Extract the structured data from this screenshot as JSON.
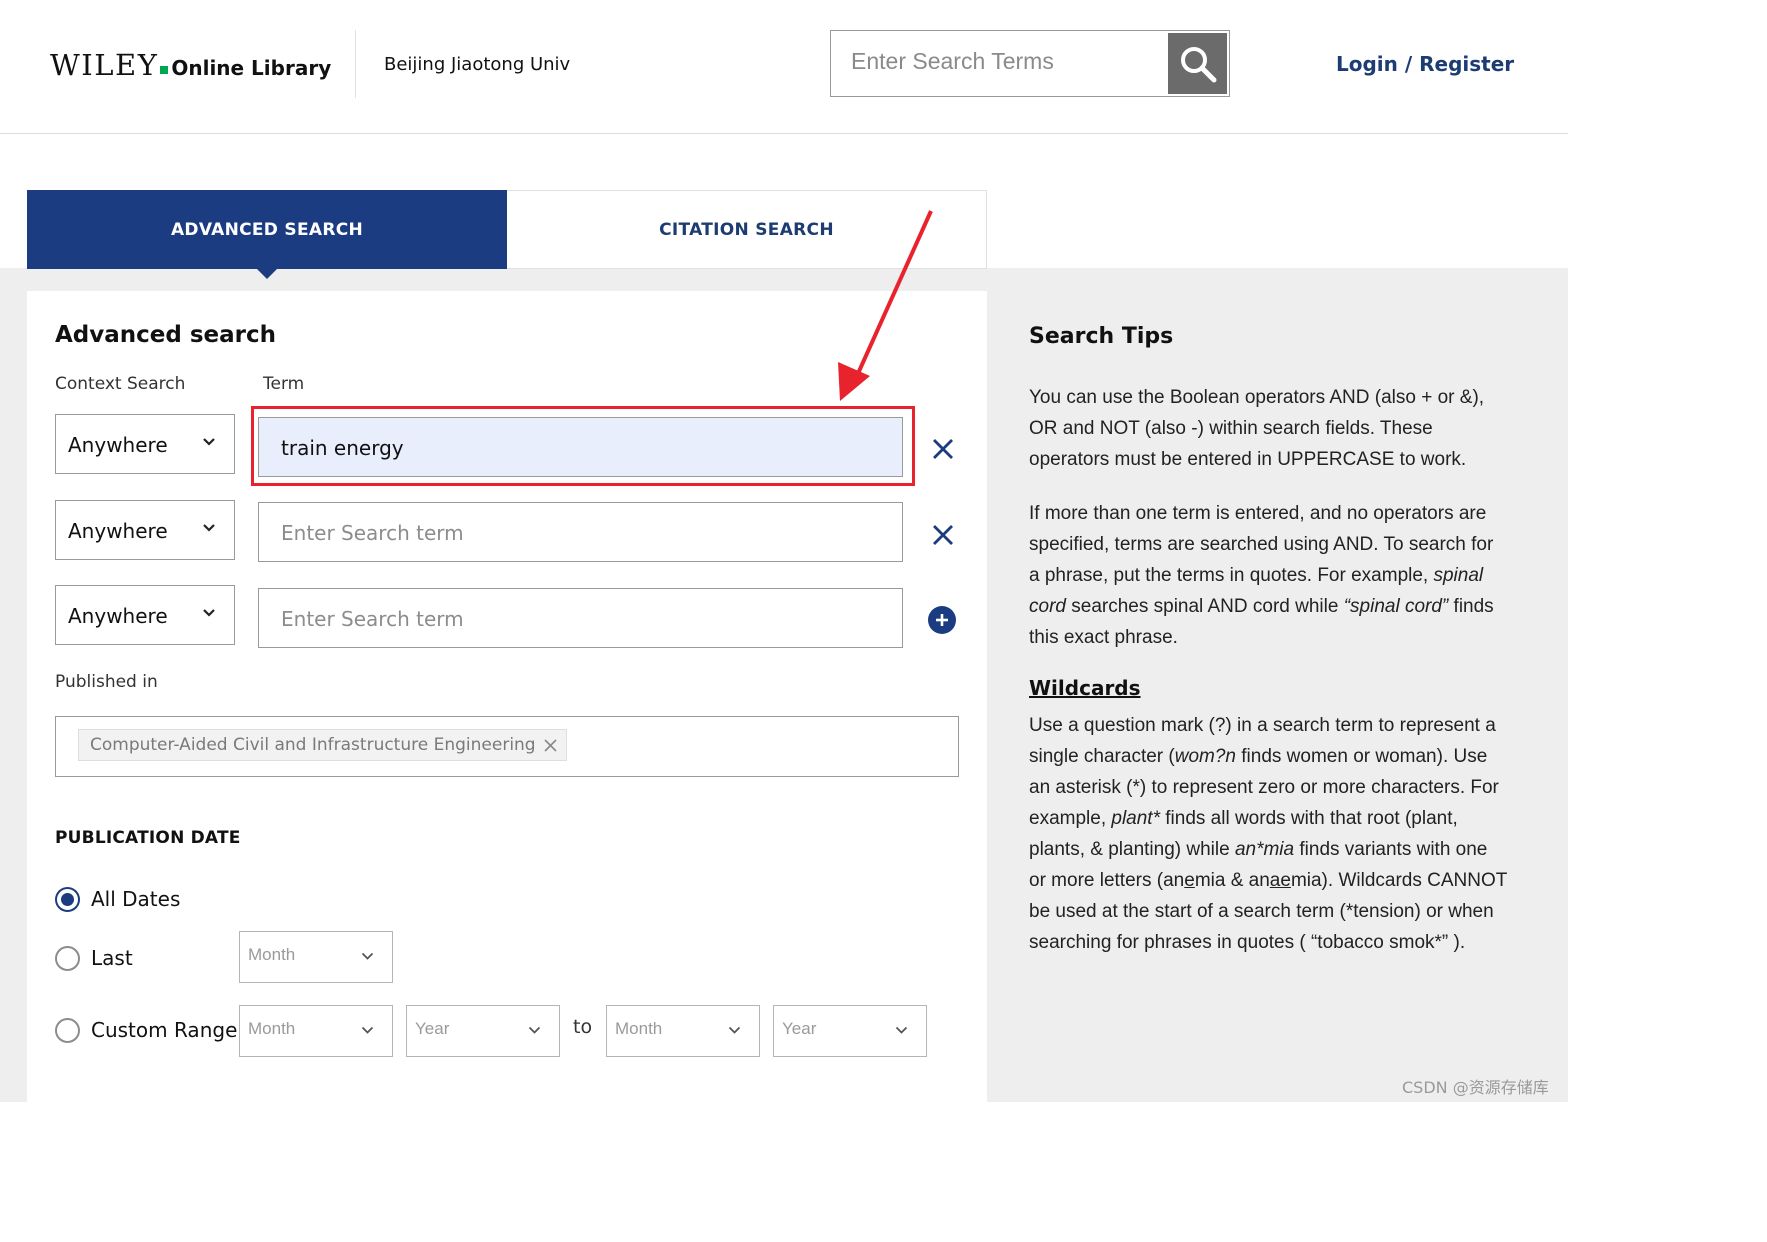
{
  "header": {
    "logo_wiley": "WILEY",
    "logo_online_library": "Online Library",
    "institution": "Beijing Jiaotong Univ",
    "search_placeholder": "Enter Search Terms",
    "login_register": "Login / Register"
  },
  "tabs": [
    {
      "label": "ADVANCED SEARCH",
      "active": true
    },
    {
      "label": "CITATION SEARCH",
      "active": false
    }
  ],
  "advanced": {
    "title": "Advanced search",
    "context_label": "Context Search",
    "term_label": "Term",
    "rows": [
      {
        "context": "Anywhere",
        "term": "train energy",
        "placeholder": "Enter Search term",
        "action": "remove"
      },
      {
        "context": "Anywhere",
        "term": "",
        "placeholder": "Enter Search term",
        "action": "remove"
      },
      {
        "context": "Anywhere",
        "term": "",
        "placeholder": "Enter Search term",
        "action": "add"
      }
    ],
    "published_in_label": "Published in",
    "published_in_chip": "Computer-Aided Civil and Infrastructure Engineering",
    "publication_date_label": "PUBLICATION DATE",
    "date_options": [
      {
        "label": "All Dates",
        "checked": true
      },
      {
        "label": "Last",
        "checked": false
      },
      {
        "label": "Custom Range",
        "checked": false
      }
    ],
    "last_month": "Month",
    "range_from_month": "Month",
    "range_from_year": "Year",
    "range_to": "to",
    "range_to_month": "Month",
    "range_to_year": "Year"
  },
  "tips": {
    "title": "Search Tips",
    "p1": "You can use the Boolean operators AND (also + or &), OR and NOT (also -) within search fields. These operators must be entered in UPPERCASE to work.",
    "p2_a": "If more than one term is entered, and no operators are specified, terms are searched using AND.  To search for a phrase, put the terms in quotes.  For example, ",
    "p2_em1": "spinal cord",
    "p2_b": " searches spinal AND cord while ",
    "p2_em2": "“spinal cord”",
    "p2_c": " finds this exact phrase.",
    "wildcards_title": "Wildcards",
    "p3_a": "Use a question mark (?) in a search term to represent a single character (",
    "p3_em1": "wom?n",
    "p3_b": " finds women or woman).  Use an asterisk (*) to represent zero or more characters.   For example, ",
    "p3_em2": "plant*",
    "p3_c": " finds all words with that root (plant, plants, & planting) while ",
    "p3_em3": "an*mia",
    "p3_d": " finds variants with one or more letters (an",
    "p3_u1": "e",
    "p3_e": "mia & an",
    "p3_u2": "ae",
    "p3_f": "mia).  Wildcards CANNOT be used at the start of a search term (*tension) or when searching for phrases in quotes ( “tobacco smok*” )."
  },
  "watermark": "CSDN @资源存储库",
  "colors": {
    "brand_blue": "#1c3c82",
    "link_blue": "#1c3c72",
    "highlight_red": "#e8232e",
    "wiley_green": "#00a651"
  }
}
